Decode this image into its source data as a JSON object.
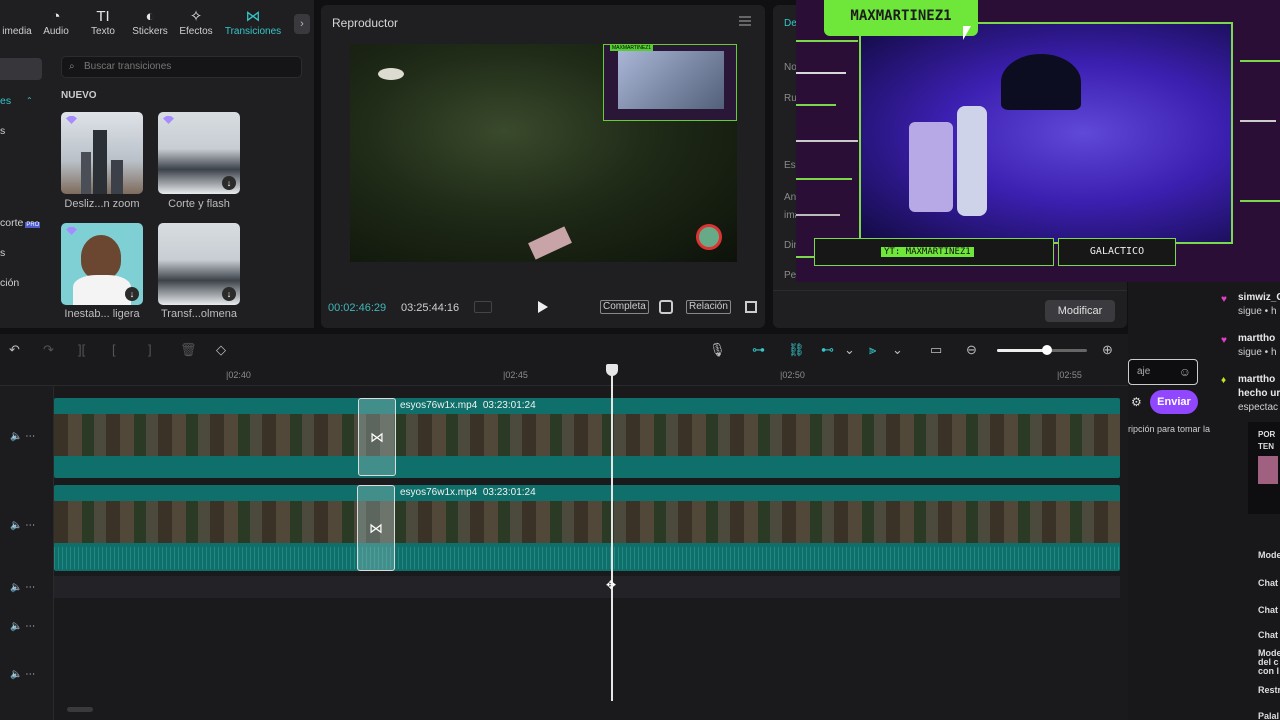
{
  "media_tabs": [
    {
      "label": "imedia",
      "icon": "media-icon"
    },
    {
      "label": "Audio",
      "icon": "audio-icon"
    },
    {
      "label": "Texto",
      "icon": "text-icon"
    },
    {
      "label": "Stickers",
      "icon": "sticker-icon"
    },
    {
      "label": "Efectos",
      "icon": "effects-icon"
    },
    {
      "label": "Transiciones",
      "icon": "transitions-icon",
      "active": true
    }
  ],
  "icons": {
    "audio": "◔",
    "texto": "TI",
    "stickers": "◐",
    "efectos": "✧",
    "transiciones": "⋈",
    "more": "›",
    "search": "⌕",
    "download": "↓"
  },
  "sidebar": {
    "items": [
      "es",
      "s",
      "corte",
      "s",
      "ción"
    ],
    "badge": "PRO"
  },
  "search": {
    "placeholder": "Buscar transiciones"
  },
  "section_title": "NUEVO",
  "transitions": [
    {
      "label": "Desliz...n zoom"
    },
    {
      "label": "Corte y flash"
    },
    {
      "label": "Inestab... ligera"
    },
    {
      "label": "Transf...olmena"
    }
  ],
  "player": {
    "title": "Reproductor",
    "current_time": "00:02:46:29",
    "total_time": "03:25:44:16",
    "full_btn": "Completa",
    "ratio_btn": "Relación",
    "pip_name": "MAXMARTINEZ1"
  },
  "details": {
    "labels": [
      "De",
      "No",
      "Ru",
      "Es",
      "An",
      "ima",
      "Dir",
      "Pe"
    ],
    "modify_label": "Modificar"
  },
  "overlay": {
    "streamer_name": "MAXMARTINEZ1",
    "yt_label": "YT: MAXMARTINEZ1",
    "team_label": "GALACTICO"
  },
  "chat": {
    "messages": [
      {
        "user": "simwiz_C",
        "text": "sigue • h"
      },
      {
        "user": "marttho",
        "text": "sigue • h"
      },
      {
        "user": "marttho",
        "text": "hecho ur"
      }
    ],
    "extra_line": "espectac",
    "input_placeholder": "aje",
    "send_label": "Enviar",
    "sub_note": "ripción para tomar la",
    "promo_top": "POR",
    "promo_sub": "TEN",
    "side_labels": [
      "Mode",
      "Chat",
      "Chat",
      "Chat",
      "Mode",
      "del c",
      "con l",
      "Restr",
      "Palal"
    ]
  },
  "timeline": {
    "ruler_labels": [
      "02:40",
      "02:45",
      "02:50",
      "02:55"
    ],
    "clips": [
      {
        "name": "esyos76w1x.mp4",
        "duration": "03:23:01:24"
      },
      {
        "name": "esyos76w1x.mp4",
        "duration": "03:23:01:24"
      }
    ],
    "zoom_level": 0.55,
    "toolbar_icons": [
      "undo-icon",
      "redo-icon",
      "split-icon",
      "split-left-icon",
      "split-right-icon",
      "delete-icon",
      "marker-icon"
    ]
  },
  "colors": {
    "accent": "#34c7c9",
    "clip": "#0f6f6a",
    "twitch": "#9147ff",
    "overlay_green": "#6ee73a"
  }
}
